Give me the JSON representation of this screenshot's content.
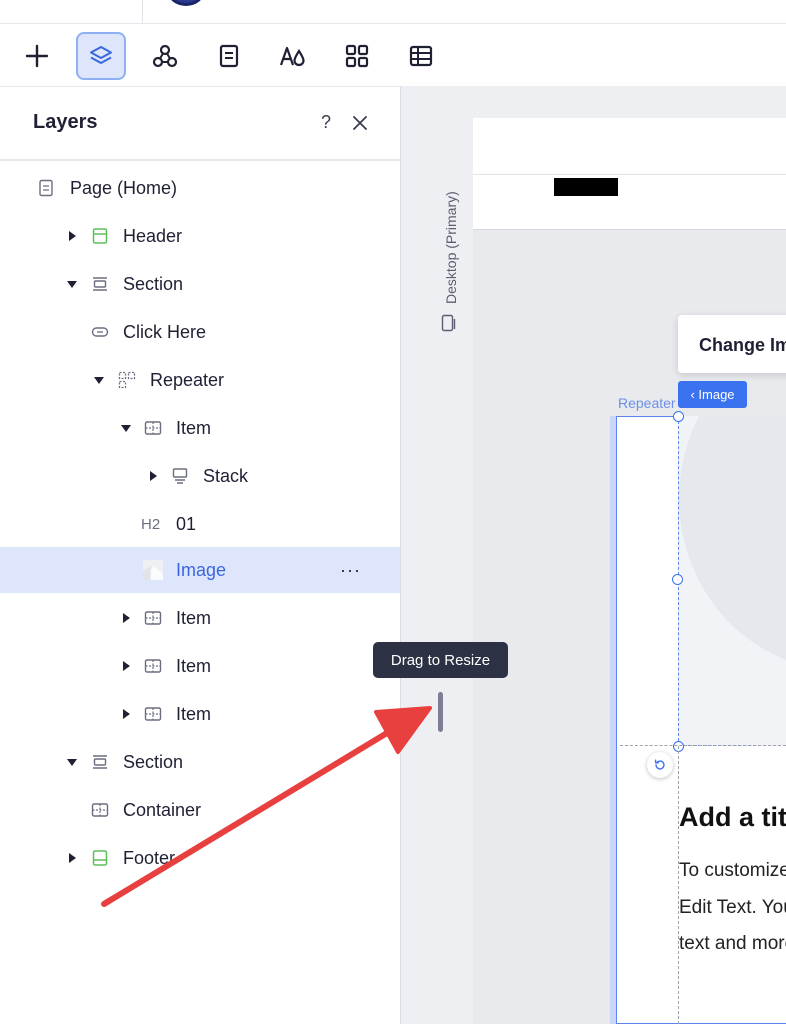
{
  "layers_panel": {
    "title": "Layers",
    "help_label": "?",
    "rows": [
      {
        "label": "Page (Home)"
      },
      {
        "label": "Header"
      },
      {
        "label": "Section"
      },
      {
        "label": "Click Here"
      },
      {
        "label": "Repeater"
      },
      {
        "label": "Item"
      },
      {
        "label": "Stack"
      },
      {
        "label": "01",
        "tag": "H2"
      },
      {
        "label": "Image",
        "more": "···"
      },
      {
        "label": "Item"
      },
      {
        "label": "Item"
      },
      {
        "label": "Item"
      },
      {
        "label": "Section"
      },
      {
        "label": "Container"
      },
      {
        "label": "Footer"
      }
    ]
  },
  "canvas": {
    "device_label": "Desktop (Primary)",
    "change_image_label": "Change Image",
    "repeater_tag": "Repeater",
    "image_tag": "‹ Image",
    "item_title": "Add a title",
    "item_text_lines": [
      "To customize",
      "Edit Text. You",
      "text and more"
    ]
  },
  "tooltip": "Drag to Resize",
  "colors": {
    "accent": "#3b72f0",
    "selected_row": "#dde6fb",
    "arrow": "#e8403f",
    "tooltip_bg": "#2c3143"
  },
  "toolbar_icons": [
    "add-icon",
    "layers-icon",
    "connections-icon",
    "pages-icon",
    "typography-icon",
    "apps-icon",
    "table-icon"
  ]
}
